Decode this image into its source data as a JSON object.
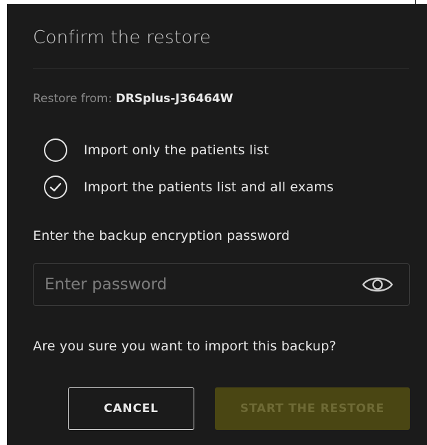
{
  "dialog": {
    "title": "Confirm the restore",
    "restore_from_label": "Restore from:",
    "restore_from_value": "DRSplus-J36464W",
    "options": [
      {
        "label": "Import only the patients list",
        "selected": false,
        "icon": "radio-empty-icon"
      },
      {
        "label": "Import the patients list and all exams",
        "selected": true,
        "icon": "radio-check-icon"
      }
    ],
    "password": {
      "label": "Enter the backup encryption password",
      "placeholder": "Enter password",
      "value": "",
      "toggle_icon": "eye-icon"
    },
    "confirm_question": "Are you sure you want to import this backup?",
    "buttons": {
      "cancel": "CANCEL",
      "start": "START THE RESTORE",
      "start_enabled": false
    }
  },
  "colors": {
    "background": "#1b1b1b",
    "text": "#e8e8e8",
    "muted": "#8a8a8a",
    "primary_disabled_bg": "#4a4613",
    "primary_disabled_text": "#6e6a35"
  }
}
